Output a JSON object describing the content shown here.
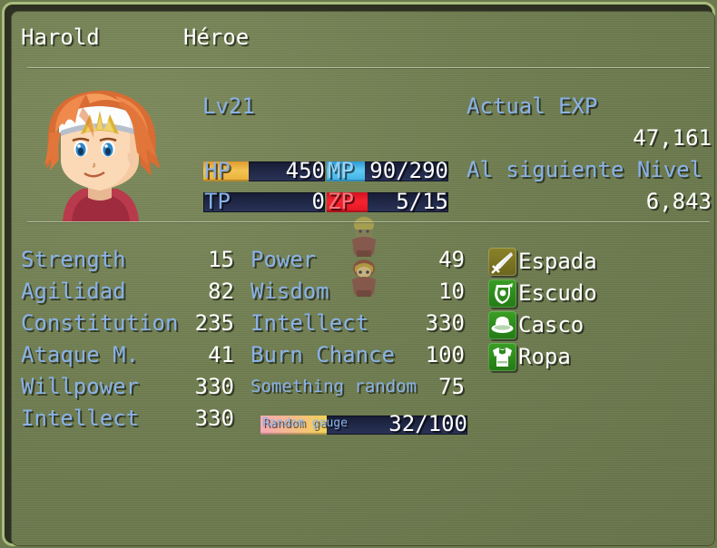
{
  "window": {
    "border_color": "#a8bd7c",
    "background_color": "#707e51",
    "label_color": "#8ab2e8",
    "value_color": "#ffffff"
  },
  "header": {
    "actor_name": "Harold",
    "actor_class": "Héroe"
  },
  "portrait": {
    "icon_name": "hero-face-portrait",
    "hair_color": "#e8844a",
    "scarf_color": "#b83a4c",
    "armor_color": "#d9dde6"
  },
  "status": {
    "level_label": "Lv",
    "level_value": "21",
    "level_text": "Lv21"
  },
  "gauges": [
    {
      "key": "hp",
      "name": "HP",
      "name_color": "#8ab2e8",
      "value_text": "450",
      "current": 450,
      "max": 1200,
      "rate": 0.37,
      "fill_color": "#f3c453"
    },
    {
      "key": "mp",
      "name": "MP",
      "name_color": "#9cd2f5",
      "value_text": "90/290",
      "current": 90,
      "max": 290,
      "rate": 0.31,
      "fill_color": "#5fc8f2"
    },
    {
      "key": "tp",
      "name": "TP",
      "name_color": "#8ab2e8",
      "value_text": "0",
      "current": 0,
      "max": 100,
      "rate": 0.0,
      "fill_color": "#55e894"
    },
    {
      "key": "zp",
      "name": "ZP",
      "name_color": "#f2787f",
      "value_text": "5/15",
      "current": 5,
      "max": 15,
      "rate": 0.333,
      "fill_color": "#f8222f"
    }
  ],
  "exp": {
    "current_label": "Actual EXP",
    "current_value": "47,161",
    "next_label": "Al siguiente Nivel",
    "next_value": "6,843"
  },
  "stats_left": [
    {
      "label": "Strength",
      "value": "15"
    },
    {
      "label": "Agilidad",
      "value": "82"
    },
    {
      "label": "Constitution",
      "value": "235"
    },
    {
      "label": "Ataque M.",
      "value": "41"
    },
    {
      "label": "Willpower",
      "value": "330"
    },
    {
      "label": "Intellect",
      "value": "330"
    }
  ],
  "stats_mid": [
    {
      "label": "Power",
      "value": "49",
      "small": false
    },
    {
      "label": "Wisdom",
      "value": "10",
      "small": false
    },
    {
      "label": "Intellect",
      "value": "330",
      "small": false
    },
    {
      "label": "Burn Chance",
      "value": "100",
      "small": false
    },
    {
      "label": "Something random",
      "value": "75",
      "small": true
    }
  ],
  "stat_gauge": {
    "name": "Random gauge",
    "value_text": "32/100",
    "current": 32,
    "max": 100,
    "rate": 0.32,
    "fill_start_color": "#f7a9b6",
    "fill_end_color": "#f2d257"
  },
  "equipment": [
    {
      "slot": "weapon",
      "icon_name": "sword-icon",
      "label": "Espada",
      "bg_color": "#7b7524"
    },
    {
      "slot": "shield",
      "icon_name": "shield-icon",
      "label": "Escudo",
      "bg_color": "#2f8a1e"
    },
    {
      "slot": "head",
      "icon_name": "helmet-icon",
      "label": "Casco",
      "bg_color": "#2f8a1e"
    },
    {
      "slot": "body",
      "icon_name": "armor-icon",
      "label": "Ropa",
      "bg_color": "#2f8a1e"
    }
  ],
  "sprites": {
    "icon_name": "party-walk-sprites",
    "count": 2
  }
}
